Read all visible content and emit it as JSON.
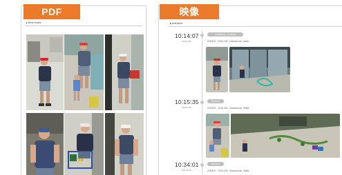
{
  "tags": {
    "pdf": "PDF",
    "video": "映像"
  },
  "pdf": {
    "header": "Best shots"
  },
  "video": {
    "section_label": "Activities",
    "events": [
      {
        "time": "10:14:07",
        "date": "2024/1/08",
        "pill": "LOITERING / IN ZONE",
        "meta": "ZONE01 · 2024/1/08 · Mustachioed, walks"
      },
      {
        "time": "10:15:35",
        "date": "2024/1/08",
        "pill": "PERSON",
        "meta": "ZONE01 · 2024/1/08 · Mustachioed, Walks"
      },
      {
        "time": "10:34:01",
        "date": "2024/1/08",
        "pill": "PERSON",
        "meta": "ZONE01 · 2024/1/08 · Mustachioed, Walks"
      }
    ]
  }
}
